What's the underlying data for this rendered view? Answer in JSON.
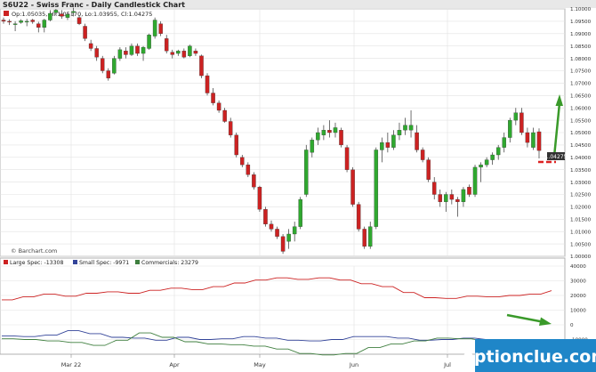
{
  "header": {
    "title": "S6U22 - Swiss Franc - Daily Candlestick Chart",
    "ohlc": "Op:1.05035, Hi:1.05170, Lo:1.03955, Cl:1.04275"
  },
  "credit": "© Barchart.com",
  "watermark": "optionclue.com",
  "colors": {
    "up": "#2fa82f",
    "down": "#cc2222",
    "large_spec": "#cc2222",
    "small_spec": "#334499",
    "commercials": "#3f7f3f",
    "annotation_red": "#dd2222",
    "annotation_green": "#3a9a2a",
    "watermark_bg": "#1f86c8"
  },
  "chart_data": [
    {
      "type": "candlestick",
      "title": "S6U22 - Swiss Franc - Daily Candlestick Chart",
      "x_labels": [
        "Mar 22",
        "Apr",
        "May",
        "Jun",
        "Jul"
      ],
      "ylim": [
        1.0,
        1.1
      ],
      "y_ticks": [
        "1.10000",
        "1.09500",
        "1.09000",
        "1.08500",
        "1.08000",
        "1.07500",
        "1.07000",
        "1.06500",
        "1.06000",
        "1.05500",
        "1.05000",
        "1.04500",
        "1.04000",
        "1.03500",
        "1.03000",
        "1.02500",
        "1.02000",
        "1.01500",
        "1.01000",
        "1.00500",
        "1.00000"
      ],
      "last_price_label": "1.04275",
      "last_price": 1.04275,
      "candles": [
        [
          1.0955,
          1.0965,
          1.094,
          1.095
        ],
        [
          1.095,
          1.0958,
          1.0935,
          1.0948
        ],
        [
          1.094,
          1.095,
          1.091,
          1.094
        ],
        [
          1.0945,
          1.0958,
          1.094,
          1.0952
        ],
        [
          1.095,
          1.096,
          1.093,
          1.095
        ],
        [
          1.0955,
          1.096,
          1.094,
          1.0948
        ],
        [
          1.094,
          1.0948,
          1.0905,
          1.0925
        ],
        [
          1.0925,
          1.096,
          1.0905,
          1.0955
        ],
        [
          1.0955,
          1.0995,
          1.095,
          1.0982
        ],
        [
          1.0985,
          1.1,
          1.0975,
          1.0995
        ],
        [
          1.098,
          1.0995,
          1.096,
          1.097
        ],
        [
          1.0965,
          1.0988,
          1.0955,
          1.0978
        ],
        [
          1.0985,
          1.1005,
          1.097,
          1.099
        ],
        [
          1.0965,
          1.0975,
          1.0935,
          1.094
        ],
        [
          1.093,
          1.094,
          1.087,
          1.088
        ],
        [
          1.086,
          1.0875,
          1.083,
          1.084
        ],
        [
          1.084,
          1.085,
          1.079,
          1.0805
        ],
        [
          1.08,
          1.081,
          1.074,
          1.075
        ],
        [
          1.075,
          1.076,
          1.071,
          1.072
        ],
        [
          1.074,
          1.081,
          1.0735,
          1.08
        ],
        [
          1.08,
          1.0845,
          1.079,
          1.0835
        ],
        [
          1.083,
          1.0845,
          1.08,
          1.0815
        ],
        [
          1.0815,
          1.086,
          1.081,
          1.085
        ],
        [
          1.085,
          1.086,
          1.081,
          1.082
        ],
        [
          1.082,
          1.085,
          1.079,
          1.0845
        ],
        [
          1.084,
          1.09,
          1.0835,
          1.0895
        ],
        [
          1.089,
          1.0965,
          1.088,
          1.0955
        ],
        [
          1.094,
          1.095,
          1.089,
          1.09
        ],
        [
          1.088,
          1.0895,
          1.082,
          1.083
        ],
        [
          1.0825,
          1.0835,
          1.08,
          1.0815
        ],
        [
          1.082,
          1.0835,
          1.081,
          1.083
        ],
        [
          1.083,
          1.084,
          1.08,
          1.0805
        ],
        [
          1.081,
          1.0855,
          1.0805,
          1.085
        ],
        [
          1.083,
          1.084,
          1.081,
          1.082
        ],
        [
          1.081,
          1.0815,
          1.072,
          1.073
        ],
        [
          1.073,
          1.074,
          1.065,
          1.066
        ],
        [
          1.066,
          1.068,
          1.061,
          1.062
        ],
        [
          1.062,
          1.063,
          1.058,
          1.059
        ],
        [
          1.059,
          1.06,
          1.054,
          1.0545
        ],
        [
          1.0545,
          1.056,
          1.048,
          1.049
        ],
        [
          1.049,
          1.05,
          1.04,
          1.041
        ],
        [
          1.04,
          1.041,
          1.036,
          1.037
        ],
        [
          1.037,
          1.038,
          1.032,
          1.033
        ],
        [
          1.033,
          1.034,
          1.027,
          1.028
        ],
        [
          1.028,
          1.0285,
          1.018,
          1.019
        ],
        [
          1.019,
          1.02,
          1.012,
          1.013
        ],
        [
          1.013,
          1.0145,
          1.01,
          1.011
        ],
        [
          1.011,
          1.012,
          1.007,
          1.008
        ],
        [
          1.008,
          1.009,
          1.001,
          1.002
        ],
        [
          1.006,
          1.011,
          1.003,
          1.009
        ],
        [
          1.009,
          1.014,
          1.006,
          1.012
        ],
        [
          1.012,
          1.024,
          1.011,
          1.023
        ],
        [
          1.025,
          1.045,
          1.024,
          1.043
        ],
        [
          1.042,
          1.048,
          1.04,
          1.047
        ],
        [
          1.047,
          1.052,
          1.045,
          1.05
        ],
        [
          1.049,
          1.053,
          1.047,
          1.051
        ],
        [
          1.051,
          1.055,
          1.048,
          1.05
        ],
        [
          1.05,
          1.054,
          1.048,
          1.052
        ],
        [
          1.051,
          1.052,
          1.044,
          1.045
        ],
        [
          1.044,
          1.045,
          1.034,
          1.035
        ],
        [
          1.035,
          1.036,
          1.02,
          1.021
        ],
        [
          1.021,
          1.022,
          1.01,
          1.011
        ],
        [
          1.011,
          1.012,
          1.003,
          1.004
        ],
        [
          1.004,
          1.014,
          1.003,
          1.012
        ],
        [
          1.012,
          1.044,
          1.011,
          1.043
        ],
        [
          1.043,
          1.048,
          1.038,
          1.046
        ],
        [
          1.046,
          1.05,
          1.042,
          1.044
        ],
        [
          1.044,
          1.051,
          1.043,
          1.049
        ],
        [
          1.049,
          1.054,
          1.047,
          1.051
        ],
        [
          1.051,
          1.056,
          1.049,
          1.053
        ],
        [
          1.051,
          1.059,
          1.048,
          1.053
        ],
        [
          1.05,
          1.053,
          1.042,
          1.043
        ],
        [
          1.043,
          1.044,
          1.038,
          1.039
        ],
        [
          1.039,
          1.04,
          1.03,
          1.031
        ],
        [
          1.03,
          1.032,
          1.023,
          1.025
        ],
        [
          1.025,
          1.027,
          1.02,
          1.022
        ],
        [
          1.022,
          1.026,
          1.018,
          1.025
        ],
        [
          1.025,
          1.027,
          1.021,
          1.023
        ],
        [
          1.023,
          1.024,
          1.016,
          1.022
        ],
        [
          1.022,
          1.028,
          1.02,
          1.027
        ],
        [
          1.028,
          1.029,
          1.024,
          1.025
        ],
        [
          1.025,
          1.037,
          1.024,
          1.036
        ],
        [
          1.036,
          1.038,
          1.03,
          1.037
        ],
        [
          1.037,
          1.04,
          1.036,
          1.039
        ],
        [
          1.039,
          1.042,
          1.037,
          1.041
        ],
        [
          1.041,
          1.045,
          1.039,
          1.044
        ],
        [
          1.044,
          1.05,
          1.042,
          1.048
        ],
        [
          1.048,
          1.056,
          1.046,
          1.055
        ],
        [
          1.055,
          1.06,
          1.053,
          1.058
        ],
        [
          1.058,
          1.06,
          1.049,
          1.05
        ],
        [
          1.05,
          1.052,
          1.044,
          1.046
        ],
        [
          1.044,
          1.052,
          1.043,
          1.05
        ],
        [
          1.05035,
          1.0517,
          1.03955,
          1.04275
        ]
      ]
    },
    {
      "type": "line",
      "legend": [
        {
          "name": "Large Spec: -13308",
          "color": "#cc2222"
        },
        {
          "name": "Small Spec: -9971",
          "color": "#334499"
        },
        {
          "name": "Commercials: 23279",
          "color": "#3f7f3f"
        }
      ],
      "ylim": [
        -20000,
        40000
      ],
      "y_ticks": [
        "40000",
        "30000",
        "20000",
        "10000",
        "0",
        "-10000"
      ],
      "series": [
        {
          "name": "Large Spec: -13308",
          "color": "#cc2222",
          "values": [
            17000,
            17000,
            19000,
            19000,
            21000,
            21000,
            19500,
            19500,
            21500,
            21500,
            22500,
            22500,
            21500,
            21500,
            23500,
            23500,
            25000,
            25000,
            24000,
            24000,
            26000,
            26000,
            28500,
            28500,
            30500,
            30500,
            32000,
            32000,
            31000,
            31000,
            32000,
            32000,
            30500,
            30500,
            28000,
            28000,
            26000,
            26000,
            22000,
            22000,
            18500,
            18500,
            18000,
            18000,
            19500,
            19500,
            19000,
            19000,
            20000,
            20000,
            21000,
            21000,
            23279
          ]
        },
        {
          "name": "Small Spec: -9971",
          "color": "#334499",
          "values": [
            -7500,
            -7500,
            -8000,
            -8000,
            -7000,
            -7000,
            -4000,
            -4000,
            -6000,
            -6000,
            -8500,
            -8500,
            -9000,
            -9000,
            -10500,
            -10500,
            -8500,
            -8500,
            -10000,
            -10000,
            -9500,
            -9500,
            -8000,
            -8000,
            -9000,
            -9000,
            -10500,
            -10500,
            -11000,
            -11000,
            -10000,
            -10000,
            -8000,
            -8000,
            -8000,
            -8000,
            -9000,
            -9000,
            -10500,
            -10500,
            -10000,
            -10000,
            -9000,
            -9000,
            -10000,
            -10000,
            -11000,
            -11000,
            -11500,
            -11500,
            -9971
          ]
        },
        {
          "name": "Commercials: 23279",
          "color": "#3f7f3f",
          "values": [
            -9500,
            -9500,
            -10000,
            -10000,
            -11000,
            -11000,
            -12000,
            -12000,
            -14000,
            -14000,
            -10500,
            -10500,
            -5500,
            -5500,
            -8500,
            -8500,
            -11500,
            -11500,
            -13000,
            -13000,
            -13500,
            -13500,
            -14500,
            -14500,
            -16500,
            -16500,
            -19500,
            -19500,
            -20500,
            -20500,
            -19500,
            -19500,
            -15500,
            -15500,
            -13000,
            -13000,
            -11000,
            -11000,
            -9000,
            -9000,
            -9500,
            -9500,
            -11000,
            -11000,
            -12000,
            -12000,
            -12500,
            -12500,
            -13308
          ]
        }
      ]
    }
  ]
}
